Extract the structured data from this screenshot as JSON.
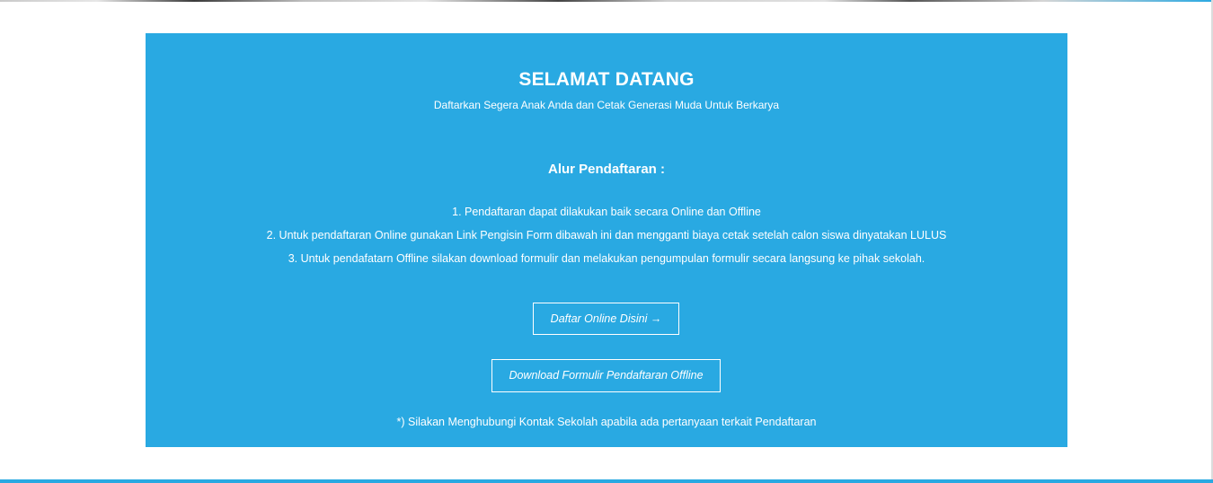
{
  "welcome": {
    "title": "SELAMAT DATANG",
    "subtitle": "Daftarkan Segera Anak Anda dan Cetak Generasi Muda Untuk Berkarya"
  },
  "registration_flow": {
    "title": "Alur Pendaftaran :",
    "steps": [
      "1. Pendaftaran dapat dilakukan baik secara Online dan Offline",
      "2. Untuk pendaftaran Online gunakan Link Pengisin Form dibawah ini dan mengganti biaya cetak setelah calon siswa dinyatakan LULUS",
      "3. Untuk pendafatarn Offline silakan download formulir dan melakukan pengumpulan formulir secara langsung ke pihak sekolah."
    ]
  },
  "buttons": {
    "online_label": "Daftar Online Disini →",
    "offline_label": "Download Formulir Pendaftaran Offline"
  },
  "note": "*) Silakan Menghubungi Kontak Sekolah apabila ada pertanyaan terkait Pendaftaran",
  "colors": {
    "panel_background": "#29a9e2",
    "text": "#ffffff",
    "page_background": "#ffffff"
  }
}
